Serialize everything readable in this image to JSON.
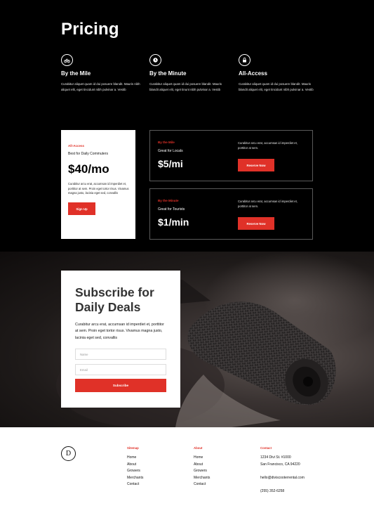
{
  "pricing": {
    "title": "Pricing",
    "features": [
      {
        "icon": "bike-icon",
        "title": "By the Mile",
        "desc": "Curabitur aliquet quam id dui posuere blandit. Mauris nibh aliquet elit, eget tincidunt nibh pulvinar a. Vestib"
      },
      {
        "icon": "clock-icon",
        "title": "By the Minute",
        "desc": "Curabitur aliquet quam id dui posuere blandit. Mauris blandit aliquet elit, eget tinunt nibh pulvinar a. Vestib"
      },
      {
        "icon": "lock-icon",
        "title": "All-Access",
        "desc": "Curabitur aliquet quam id dui posuere blandit. Mauris blandit aliquet elit, eget tincidunt nibh pulvinar a. Vestib"
      }
    ],
    "all_access": {
      "eyebrow": "All-Access",
      "subtitle": "Best for Daily Commuters",
      "price": "$40/mo",
      "desc": "Curabitur arcu erat, accumsan id imperdiet et, porttitor at sem. Proin eget tortor risus. Vivamus magna justo, lacinia eget sed, convallis",
      "button": "Sign Up"
    },
    "by_mile": {
      "eyebrow": "By the Mile",
      "subtitle": "Great for Locals",
      "price": "$5/mi",
      "desc": "Curabitur arcu erat, accumsan id imperdiet et, porttitor at sem.",
      "button": "Reserve Now"
    },
    "by_minute": {
      "eyebrow": "By the Minute",
      "subtitle": "Great for Tourists",
      "price": "$1/min",
      "desc": "Curabitur arcu erat, accumsan id imperdiet et, porttitor at sem.",
      "button": "Reserve Now"
    }
  },
  "subscribe": {
    "title_line1": "Subscribe for",
    "title_line2": "Daily Deals",
    "desc": "Curabitur arcu erat, accumsan id imperdiet et, porttitor at sem. Proin eget tortor risus. Vivamus magna justo, lacinia eget sed, convallis",
    "name_placeholder": "Name",
    "email_placeholder": "Email",
    "button": "Subscribe"
  },
  "footer": {
    "logo_letter": "D",
    "sitemap": {
      "heading": "Sitemap",
      "links": [
        "Home",
        "About",
        "Growers",
        "Merchants",
        "Contact"
      ]
    },
    "about": {
      "heading": "About",
      "links": [
        "Home",
        "About",
        "Growers",
        "Merchants",
        "Contact"
      ]
    },
    "contact": {
      "heading": "Contact",
      "address1": "1234 Divi St. #1000",
      "address2": "San Francisco, CA 94220",
      "email": "hello@diviscooterrental.com",
      "phone": "(255) 352-6258"
    }
  },
  "colors": {
    "accent": "#e03128",
    "dark": "#000000",
    "light": "#ffffff"
  }
}
